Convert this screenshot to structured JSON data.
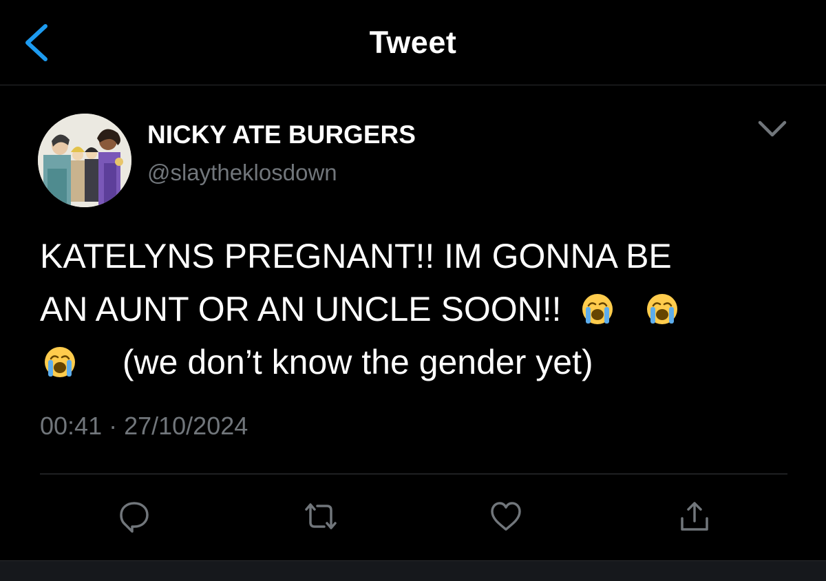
{
  "header": {
    "title": "Tweet",
    "back_icon": "chevron-left-icon",
    "accent_color": "#1d9bf0"
  },
  "tweet": {
    "author": {
      "display_name": "NICKY ATE BURGERS",
      "handle": "@slaytheklosdown",
      "avatar_icon": "profile-avatar-illustration"
    },
    "menu_icon": "chevron-down-icon",
    "text_lines": [
      "KATELYNS PREGNANT!! IM GONNA BE",
      "AN AUNT OR AN UNCLE SOON!!",
      "(we don’t know the gender yet)"
    ],
    "emoji": "loudly-crying-face",
    "time": "00:41",
    "separator": "·",
    "date": "27/10/2024"
  },
  "actions": [
    {
      "name": "reply",
      "icon": "reply-icon"
    },
    {
      "name": "retweet",
      "icon": "retweet-icon"
    },
    {
      "name": "like",
      "icon": "heart-icon"
    },
    {
      "name": "share",
      "icon": "share-icon"
    }
  ],
  "colors": {
    "background": "#000000",
    "text_primary": "#ffffff",
    "text_secondary": "#71767b",
    "icon": "#71767b"
  }
}
